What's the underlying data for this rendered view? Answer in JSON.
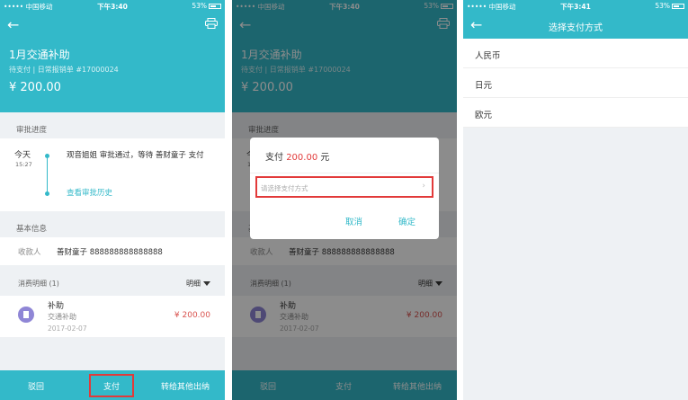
{
  "status": {
    "carrier": "••••• 中国移动",
    "battery": "53%",
    "time1": "下午3:40",
    "time2": "下午3:40",
    "time3": "下午3:41"
  },
  "expense": {
    "title": "1月交通补助",
    "meta": "待支付 | 日常报销单 #17000024",
    "amount": "¥ 200.00"
  },
  "approval": {
    "header": "审批进度",
    "day": "今天",
    "clock": "15:27",
    "text": "观音姐姐 审批通过，等待 善财童子 支付",
    "history_link": "查看审批历史"
  },
  "basic": {
    "header": "基本信息",
    "payee_label": "收款人",
    "payee_value": "善财童子 888888888888888"
  },
  "details": {
    "header": "消费明细 (1)",
    "toggle": "明细",
    "item": {
      "name": "补助",
      "type": "交通补助",
      "date": "2017-02-07",
      "amount": "¥ 200.00"
    }
  },
  "tabbar": {
    "reject": "驳回",
    "pay": "支付",
    "transfer": "转给其他出纳"
  },
  "dialog": {
    "title_pre": "支付",
    "title_amount": "200.00",
    "title_post": "元",
    "placeholder": "请选择支付方式",
    "cancel": "取消",
    "confirm": "确定"
  },
  "payment_method": {
    "title": "选择支付方式",
    "options": [
      "人民币",
      "日元",
      "欧元"
    ]
  },
  "colors": {
    "accent": "#33b9c9",
    "highlight": "#e23a3a",
    "amount": "#d9534f"
  }
}
